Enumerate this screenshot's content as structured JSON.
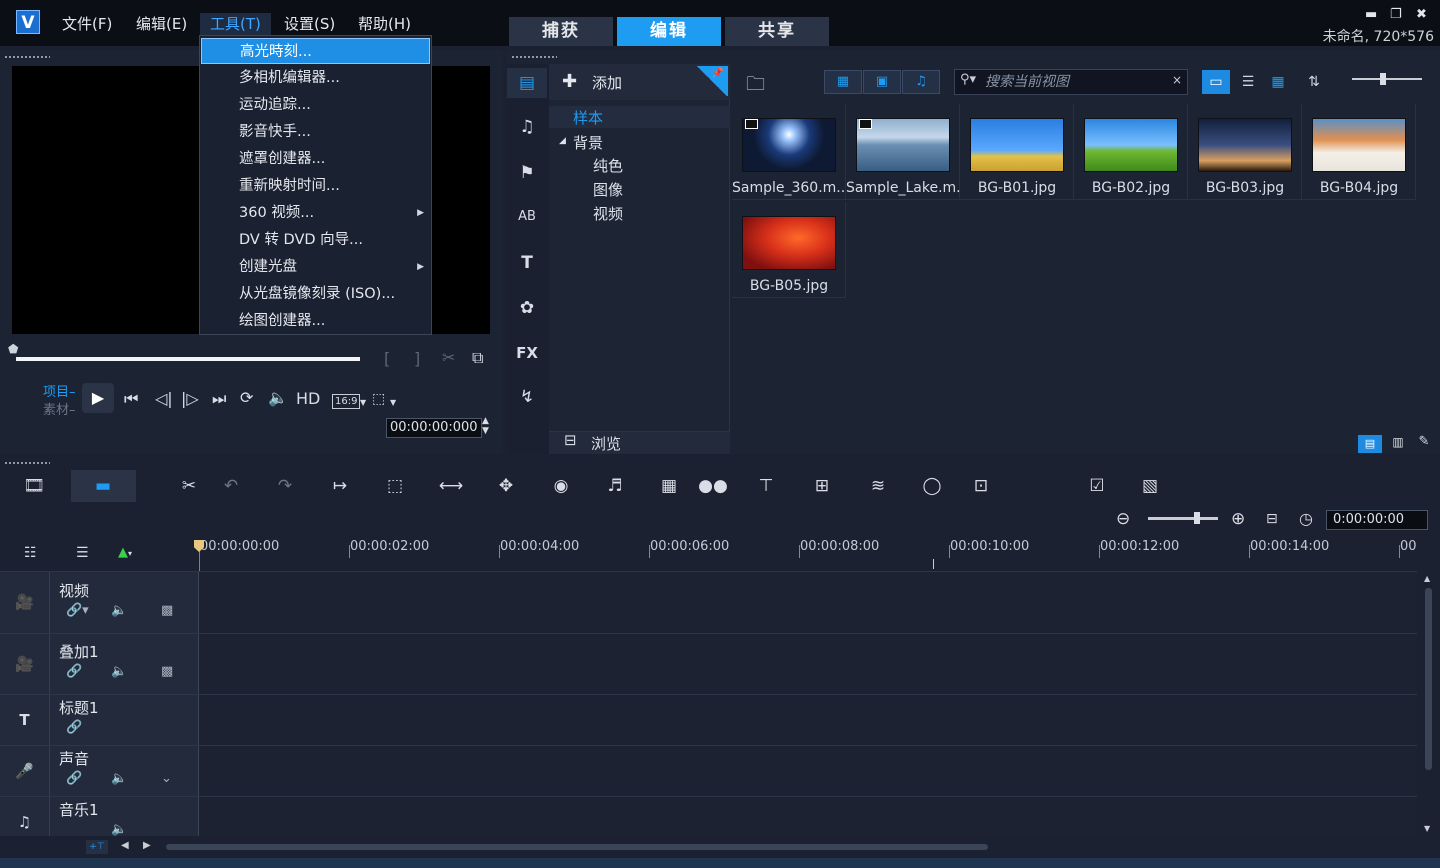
{
  "menu": {
    "logo": "V",
    "file": "文件(F)",
    "edit": "编辑(E)",
    "tools": "工具(T)",
    "settings": "设置(S)",
    "help": "帮助(H)"
  },
  "mode_tabs": {
    "capture": "捕获",
    "edit": "编辑",
    "share": "共享"
  },
  "project_info": "未命名, 720*576",
  "tools_menu": {
    "items": [
      "高光時刻...",
      "多相机编辑器...",
      "运动追踪...",
      "影音快手...",
      "遮罩创建器...",
      "重新映射时间...",
      "360 视频...",
      "DV 转 DVD 向导...",
      "创建光盘",
      "从光盘镜像刻录 (ISO)...",
      "绘图创建器..."
    ]
  },
  "preview": {
    "project_label": "项目",
    "clip_label": "素材",
    "hd": "HD",
    "aspect": "16:9",
    "timecode": "00:00:00:000"
  },
  "library": {
    "add_label": "添加",
    "tree": {
      "sample": "样本",
      "background": "背景",
      "solid": "纯色",
      "image": "图像",
      "video": "视频"
    },
    "browse_label": "浏览",
    "search_placeholder": "搜索当前视图",
    "thumbnails": [
      {
        "label": "Sample_360.m..."
      },
      {
        "label": "Sample_Lake.m..."
      },
      {
        "label": "BG-B01.jpg"
      },
      {
        "label": "BG-B02.jpg"
      },
      {
        "label": "BG-B03.jpg"
      },
      {
        "label": "BG-B04.jpg"
      },
      {
        "label": "BG-B05.jpg"
      }
    ],
    "fx_label": "FX"
  },
  "timeline": {
    "timecode": "0:00:00:00",
    "ruler": [
      "00:00:00:00",
      "00:00:02:00",
      "00:00:04:00",
      "00:00:06:00",
      "00:00:08:00",
      "00:00:10:00",
      "00:00:12:00",
      "00:00:14:00",
      "00"
    ],
    "tracks": [
      {
        "name": "视频"
      },
      {
        "name": "叠加1"
      },
      {
        "name": "标题1"
      },
      {
        "name": "声音"
      },
      {
        "name": "音乐1"
      }
    ]
  }
}
